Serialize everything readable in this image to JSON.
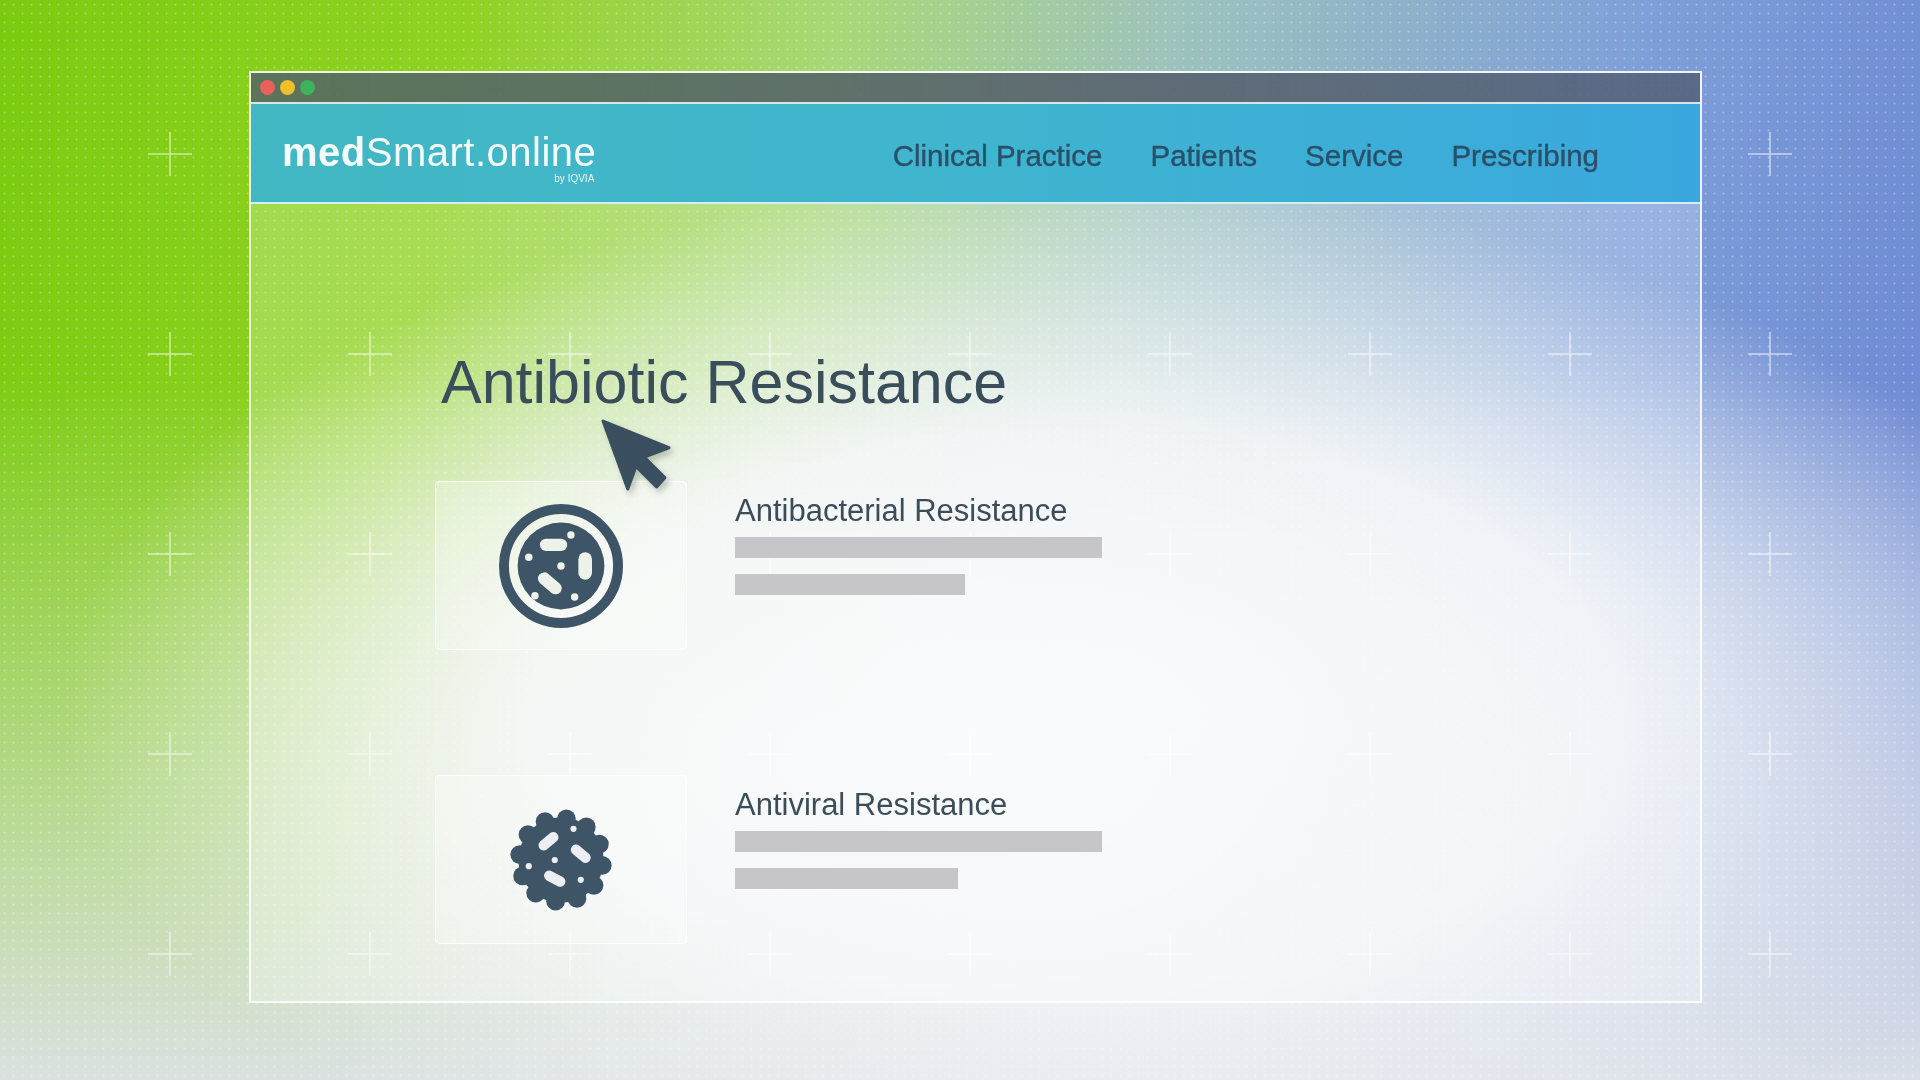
{
  "window": {
    "logo": "**med**Smart.online",
    "logo_tagline": "by IQVIA",
    "nav": [
      "Clinical Practice",
      "Patients",
      "Service",
      "Prescribing"
    ]
  },
  "page": {
    "heading": "Antibiotic Resistance",
    "topics": [
      {
        "kind": "dish",
        "title": "Antibacterial Resistance"
      },
      {
        "kind": "germ",
        "title": "Antiviral Resistance"
      }
    ]
  }
}
